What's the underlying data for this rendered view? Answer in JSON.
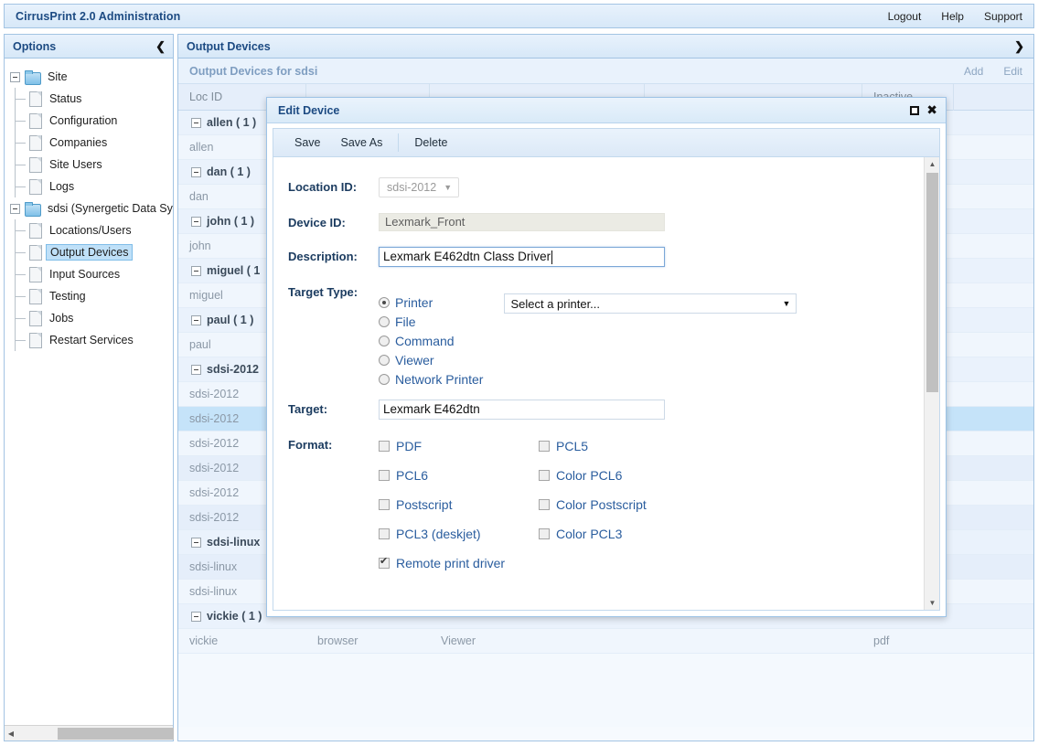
{
  "topbar": {
    "title": "CirrusPrint 2.0 Administration",
    "menu": [
      "Logout",
      "Help",
      "Support"
    ]
  },
  "options_panel": {
    "header": "Options",
    "collapse_icon": "chevron-left-icon",
    "tree": [
      {
        "label": "Site",
        "type": "folder",
        "level": 0,
        "selected": false
      },
      {
        "label": "Status",
        "type": "file",
        "level": 1,
        "selected": false
      },
      {
        "label": "Configuration",
        "type": "file",
        "level": 1,
        "selected": false
      },
      {
        "label": "Companies",
        "type": "file",
        "level": 1,
        "selected": false
      },
      {
        "label": "Site Users",
        "type": "file",
        "level": 1,
        "selected": false
      },
      {
        "label": "Logs",
        "type": "file",
        "level": 1,
        "selected": false
      },
      {
        "label": "sdsi (Synergetic Data Syste",
        "type": "folder",
        "level": 0,
        "selected": false
      },
      {
        "label": "Locations/Users",
        "type": "file",
        "level": 1,
        "selected": false
      },
      {
        "label": "Output Devices",
        "type": "file",
        "level": 1,
        "selected": true
      },
      {
        "label": "Input Sources",
        "type": "file",
        "level": 1,
        "selected": false
      },
      {
        "label": "Testing",
        "type": "file",
        "level": 1,
        "selected": false
      },
      {
        "label": "Jobs",
        "type": "file",
        "level": 1,
        "selected": false
      },
      {
        "label": "Restart Services",
        "type": "file",
        "level": 1,
        "selected": false
      }
    ]
  },
  "content_panel": {
    "header": "Output Devices",
    "expand_icon": "chevron-right-icon",
    "subheader": "Output Devices for sdsi",
    "actions": [
      "Add",
      "Edit"
    ],
    "grid": {
      "columns": [
        "Loc ID",
        "",
        "",
        "",
        "Inactive"
      ],
      "rows": [
        {
          "kind": "group",
          "label": "allen ( 1 )"
        },
        {
          "kind": "data",
          "cells": [
            "allen",
            "",
            "",
            "",
            ""
          ],
          "selected": false
        },
        {
          "kind": "group",
          "label": "dan ( 1 )"
        },
        {
          "kind": "data",
          "cells": [
            "dan",
            "",
            "",
            "",
            ""
          ],
          "selected": false
        },
        {
          "kind": "group",
          "label": "john ( 1 )"
        },
        {
          "kind": "data",
          "cells": [
            "john",
            "",
            "",
            "",
            ""
          ],
          "selected": false
        },
        {
          "kind": "group",
          "label": "miguel ( 1"
        },
        {
          "kind": "data",
          "cells": [
            "miguel",
            "",
            "",
            "",
            ""
          ],
          "selected": false
        },
        {
          "kind": "group",
          "label": "paul ( 1 )"
        },
        {
          "kind": "data",
          "cells": [
            "paul",
            "",
            "",
            "",
            ""
          ],
          "selected": false
        },
        {
          "kind": "group",
          "label": "sdsi-2012"
        },
        {
          "kind": "data",
          "cells": [
            "sdsi-2012",
            "",
            "",
            "",
            ""
          ],
          "selected": false
        },
        {
          "kind": "data",
          "cells": [
            "sdsi-2012",
            "",
            "",
            "",
            ""
          ],
          "selected": true
        },
        {
          "kind": "data",
          "cells": [
            "sdsi-2012",
            "",
            "",
            "",
            ""
          ],
          "selected": false
        },
        {
          "kind": "data",
          "cells": [
            "sdsi-2012",
            "",
            "",
            "",
            ""
          ],
          "selected": false
        },
        {
          "kind": "data",
          "cells": [
            "sdsi-2012",
            "",
            "",
            "",
            ""
          ],
          "selected": false
        },
        {
          "kind": "data",
          "cells": [
            "sdsi-2012",
            "",
            "",
            "",
            ""
          ],
          "selected": false
        },
        {
          "kind": "group",
          "label": "sdsi-linux"
        },
        {
          "kind": "data",
          "cells": [
            "sdsi-linux",
            "",
            "",
            "",
            ""
          ],
          "selected": false
        },
        {
          "kind": "data",
          "cells": [
            "sdsi-linux",
            "",
            "",
            "",
            ""
          ],
          "selected": false
        },
        {
          "kind": "group",
          "label": "vickie ( 1 )"
        },
        {
          "kind": "data",
          "cells": [
            "vickie",
            "browser",
            "Viewer",
            "",
            "pdf"
          ],
          "selected": false
        }
      ]
    }
  },
  "dialog": {
    "title": "Edit Device",
    "restore_icon": "restore-window-icon",
    "close_icon": "close-icon",
    "toolbar": [
      "Save",
      "Save As",
      "Delete"
    ],
    "fields": {
      "location_id_label": "Location ID:",
      "location_id_value": "sdsi-2012",
      "device_id_label": "Device ID:",
      "device_id_value": "Lexmark_Front",
      "description_label": "Description:",
      "description_value": "Lexmark E462dtn Class Driver",
      "target_type_label": "Target Type:",
      "target_label": "Target:",
      "target_value": "Lexmark E462dtn",
      "format_label": "Format:",
      "printer_select_value": "Select a printer..."
    },
    "target_types": [
      {
        "label": "Printer",
        "checked": true
      },
      {
        "label": "File",
        "checked": false
      },
      {
        "label": "Command",
        "checked": false
      },
      {
        "label": "Viewer",
        "checked": false
      },
      {
        "label": "Network Printer",
        "checked": false
      }
    ],
    "formats": [
      {
        "label": "PDF",
        "checked": false
      },
      {
        "label": "PCL5",
        "checked": false
      },
      {
        "label": "PCL6",
        "checked": false
      },
      {
        "label": "Color PCL6",
        "checked": false
      },
      {
        "label": "Postscript",
        "checked": false
      },
      {
        "label": "Color Postscript",
        "checked": false
      },
      {
        "label": "PCL3 (deskjet)",
        "checked": false
      },
      {
        "label": "Color PCL3",
        "checked": false
      },
      {
        "label": "Remote print driver",
        "checked": true
      }
    ]
  },
  "colors": {
    "accent": "#1c4a82",
    "panel_border": "#a3c4e3",
    "row_selected": "#c5e3f9",
    "link_blue": "#2a5d9e"
  }
}
